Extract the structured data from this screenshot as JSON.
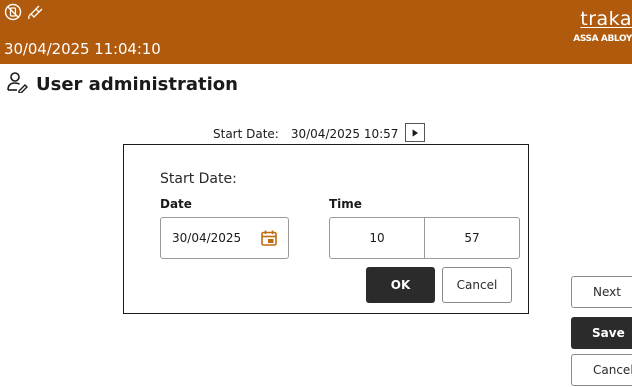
{
  "header": {
    "datetime": "30/04/2025 11:04:10",
    "brand_name": "traka",
    "brand_sub": "ASSA ABLOY",
    "background_color": "#b05a0e",
    "status_icons": [
      "no-network-icon",
      "power-plug-icon"
    ]
  },
  "page": {
    "title": "User administration",
    "title_icon": "user-edit-icon"
  },
  "start_summary": {
    "label": "Start Date:",
    "value": "30/04/2025 10:57",
    "arrow_icon": "play-arrow-icon"
  },
  "dialog": {
    "title": "Start Date:",
    "date_label": "Date",
    "time_label": "Time",
    "date_value": "30/04/2025",
    "calendar_icon": "calendar-icon",
    "hour_value": "10",
    "minute_value": "57",
    "ok_label": "OK",
    "cancel_label": "Cancel"
  },
  "side_actions": {
    "next_label": "Next",
    "save_label": "Save",
    "cancel_label": "Cancel"
  }
}
